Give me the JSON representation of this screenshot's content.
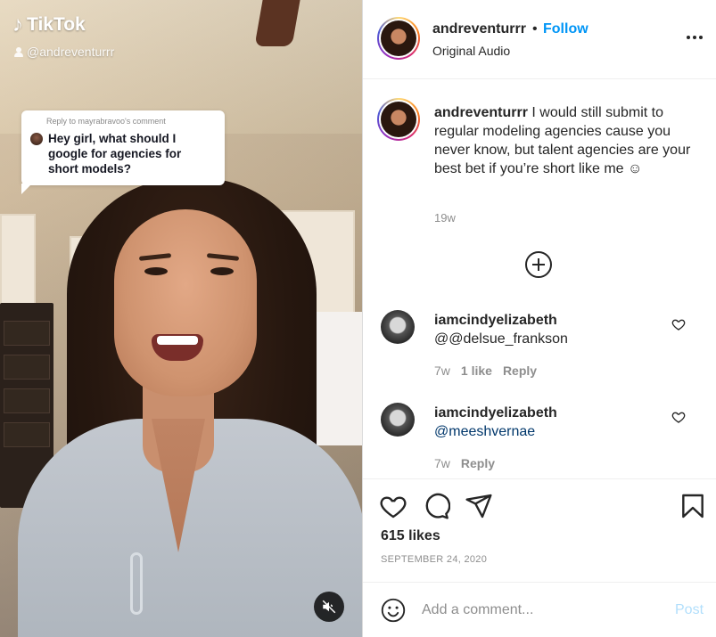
{
  "video": {
    "brand": "TikTok",
    "handle": "@andreventurrr",
    "reply_header": "Reply to mayrabravoo's comment",
    "reply_text": "Hey girl, what should I google for agencies for short models?"
  },
  "header": {
    "username": "andreventurrr",
    "separator": "•",
    "follow_label": "Follow",
    "subtitle": "Original Audio"
  },
  "caption": {
    "username": "andreventurrr",
    "text": "I would still submit to regular modeling agencies cause you never know, but talent agencies are your best bet if you’re short like me ☺",
    "age": "19w"
  },
  "comments": [
    {
      "username": "iamcindyelizabeth",
      "text": "@@delsue_frankson",
      "age": "7w",
      "likes": "1 like",
      "reply": "Reply"
    },
    {
      "username": "iamcindyelizabeth",
      "text": "@meeshvernae",
      "age": "7w",
      "reply": "Reply"
    }
  ],
  "stats": {
    "likes": "615 likes",
    "date": "SEPTEMBER 24, 2020"
  },
  "compose": {
    "placeholder": "Add a comment...",
    "post_label": "Post"
  },
  "colors": {
    "accent": "#0095f6",
    "post_disabled": "#b2dffc",
    "mention": "#00376b"
  }
}
